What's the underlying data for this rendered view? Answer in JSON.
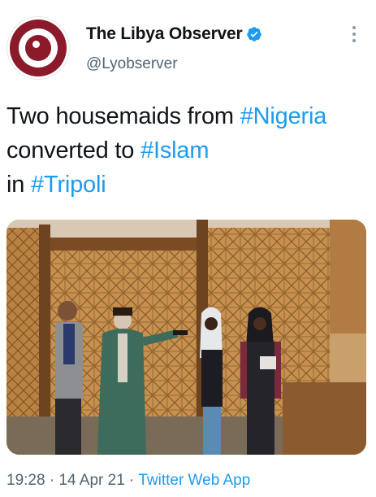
{
  "author": {
    "display_name": "The Libya Observer",
    "handle": "@Lyobserver",
    "verified_icon": "verified-badge-icon",
    "avatar_icon": "libya-observer-logo"
  },
  "tweet": {
    "segments": [
      {
        "text": "Two housemaids from ",
        "type": "text"
      },
      {
        "text": "#Nigeria",
        "type": "hashtag"
      },
      {
        "text": " converted to ",
        "type": "text"
      },
      {
        "text": "#Islam",
        "type": "hashtag"
      },
      {
        "text": " in ",
        "type": "text"
      },
      {
        "text": "#Tripoli",
        "type": "hashtag"
      }
    ]
  },
  "meta": {
    "time": "19:28",
    "sep1": " · ",
    "date": "14 Apr 21",
    "sep2": " · ",
    "source": "Twitter Web App"
  },
  "colors": {
    "link": "#1d9bf0",
    "secondary_text": "#536471",
    "brand": "#8b1a2b"
  }
}
